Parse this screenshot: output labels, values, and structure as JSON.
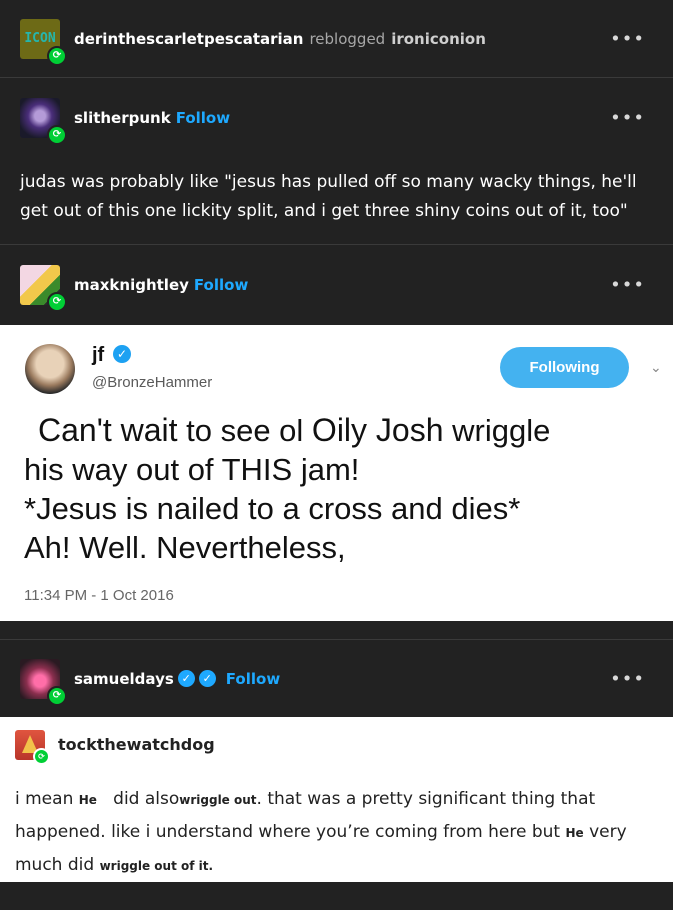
{
  "header": {
    "avatar_text": "ICON",
    "user": "derinthescarletpescatarian",
    "action": "reblogged",
    "source": "ironiconion",
    "menu": "•••"
  },
  "post1": {
    "user": "slitherpunk",
    "follow": "Follow",
    "menu": "•••",
    "text": "judas was probably like \"jesus has pulled off so many wacky things, he'll get out of this one lickity split, and i get three shiny coins out of it, too\""
  },
  "post2": {
    "user": "maxknightley",
    "follow": "Follow",
    "menu": "•••",
    "tweet": {
      "name": "jf",
      "handle": "@BronzeHammer",
      "button": "Following",
      "line1a": "Can't wait",
      "line1b": " to see ol ",
      "line1c": "Oily Josh",
      "line1d": " wriggle",
      "line2": "his way out of THIS jam!",
      "line3": "*Jesus is nailed to a cross and dies*",
      "line4": "Ah! Well. Nevertheless,",
      "time": "11:34 PM - 1 Oct 2016"
    }
  },
  "post3": {
    "user": "samueldays",
    "follow": "Follow",
    "menu": "•••",
    "reblog_user": "tockthewatchdog",
    "text": {
      "t1": "i mean ",
      "he1": "He",
      "t2": "   did also",
      "w1": "wriggle out",
      "t3": ". that was a pretty significant thing that happened. like i understand where you’re coming from here but ",
      "he2": "He",
      "t4": " very much did ",
      "w2": "wriggle out of it."
    }
  },
  "colors": {
    "accent": "#1ea9ff",
    "badge": "#00cf35",
    "background": "#222222",
    "twitter_button": "#44b2f0"
  }
}
